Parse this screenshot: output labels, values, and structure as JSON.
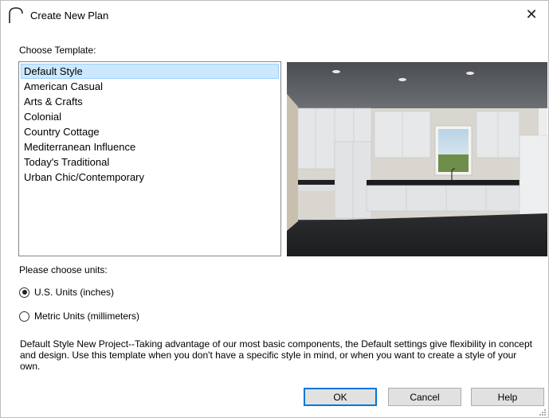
{
  "window": {
    "title": "Create New Plan",
    "close_glyph": "✕",
    "app_icon": "arch-icon"
  },
  "template_section": {
    "label": "Choose Template:",
    "templates": [
      "Default Style",
      "American Casual",
      "Arts & Crafts",
      "Colonial",
      "Country Cottage",
      "Mediterranean Influence",
      "Today's Traditional",
      "Urban Chic/Contemporary"
    ],
    "selected": "Default Style"
  },
  "units_section": {
    "label": "Please choose units:",
    "options": [
      {
        "label": "U.S. Units (inches)",
        "checked": true
      },
      {
        "label": "Metric Units (millimeters)",
        "checked": false
      }
    ]
  },
  "description": "Default Style New Project--Taking advantage of our most basic components, the Default settings give flexibility in concept and design. Use this template when you don't have a specific style in mind, or when you want to create a style of your own.",
  "buttons": {
    "ok": "OK",
    "cancel": "Cancel",
    "help": "Help"
  },
  "colors": {
    "selection_bg": "#cce8ff",
    "selection_border": "#99d1ff",
    "default_button_border": "#0078d7"
  }
}
